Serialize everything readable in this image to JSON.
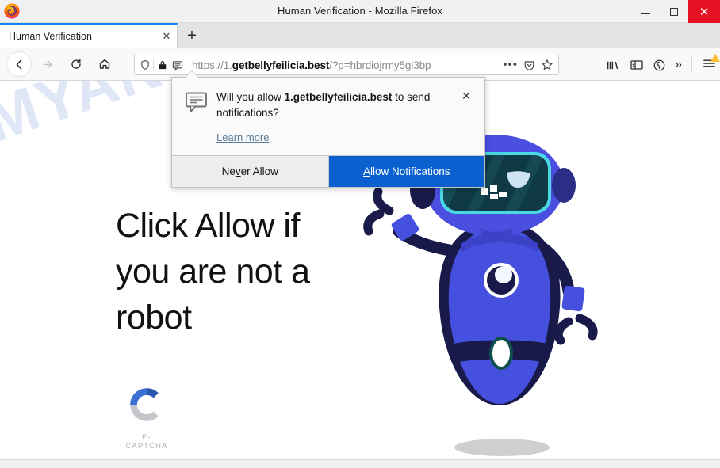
{
  "window": {
    "title": "Human Verification - Mozilla Firefox",
    "logo_icon": "firefox-logo",
    "controls": {
      "minimize": "minimize-icon",
      "maximize": "maximize-icon",
      "close": "close-icon",
      "close_glyph": "✕"
    }
  },
  "tabs": {
    "items": [
      {
        "title": "Human Verification",
        "close_glyph": "✕",
        "active": true
      }
    ],
    "new_tab_glyph": "+"
  },
  "navigation": {
    "back": "back-arrow-icon",
    "forward": "forward-arrow-icon",
    "reload": "reload-icon",
    "home": "home-icon"
  },
  "urlbar": {
    "shield_icon": "tracking-protection-shield-icon",
    "lock_icon": "padlock-icon",
    "notification_icon": "notification-permission-icon",
    "scheme": "https://",
    "subdomain": "1.",
    "host": "getbellyfeilicia.best",
    "path": "/?p=hbrdiojrmy5gi3bp",
    "full_url": "https://1.getbellyfeilicia.best/?p=hbrdiojrmy5gi3bp",
    "page_actions_glyph": "•••",
    "pocket_icon": "pocket-icon",
    "bookmark_icon": "bookmark-star-icon"
  },
  "toolbar_right": {
    "library": "library-icon",
    "sidebar": "sidebar-icon",
    "account": "account-sync-icon",
    "overflow_glyph": "»",
    "menu": "hamburger-menu-icon",
    "menu_badge": "update-warning-badge"
  },
  "doorhanger": {
    "icon": "speech-bubble-notification-icon",
    "question_prefix": "Will you allow ",
    "question_host": "1.getbellyfeilicia.best",
    "question_suffix": " to send notifications?",
    "learn_more": "Learn more",
    "close_glyph": "✕",
    "buttons": {
      "never_allow_pre": "Ne",
      "never_allow_key": "v",
      "never_allow_post": "er Allow",
      "allow_key": "A",
      "allow_post": "llow Notifications"
    },
    "primary_color": "#0a60cf"
  },
  "page": {
    "watermark": "MYANTISPYWARE.COM",
    "headline": "Click Allow if you are not a robot",
    "captcha": {
      "logo_icon": "e-captcha-c-logo",
      "label": "E-CAPTCHA",
      "color_blue": "#3b6fd4",
      "color_gray": "#c3c6cb"
    },
    "illustration": {
      "name": "waving-robot-illustration",
      "body_color": "#4650de",
      "dark_color": "#191a4a",
      "visor_color": "#0f3a45",
      "visor_border": "#4ad8e4",
      "shadow_color": "#cfcfcf"
    }
  }
}
